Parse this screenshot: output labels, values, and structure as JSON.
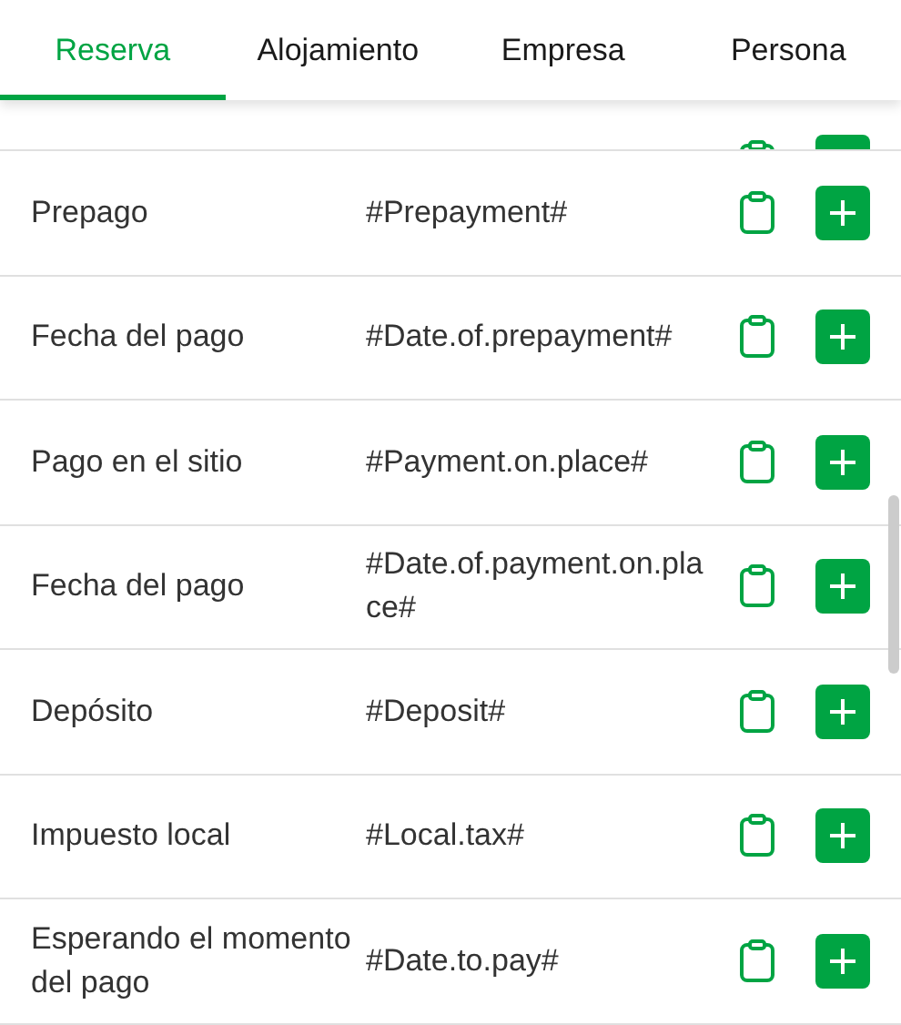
{
  "tabs": [
    {
      "label": "Reserva",
      "selected": true
    },
    {
      "label": "Alojamiento",
      "selected": false
    },
    {
      "label": "Empresa",
      "selected": false
    },
    {
      "label": "Persona",
      "selected": false
    }
  ],
  "rows": [
    {
      "label": "Prepago",
      "value": "#Prepayment#"
    },
    {
      "label": "Fecha del pago",
      "value": "#Date.of.prepayment#"
    },
    {
      "label": "Pago en el sitio",
      "value": "#Payment.on.place#"
    },
    {
      "label": "Fecha del pago",
      "value": "#Date.of.payment.on.place#"
    },
    {
      "label": "Depósito",
      "value": "#Deposit#"
    },
    {
      "label": "Impuesto local",
      "value": "#Local.tax#"
    },
    {
      "label": "Esperando el momento del pago",
      "value": "#Date.to.pay#"
    }
  ]
}
